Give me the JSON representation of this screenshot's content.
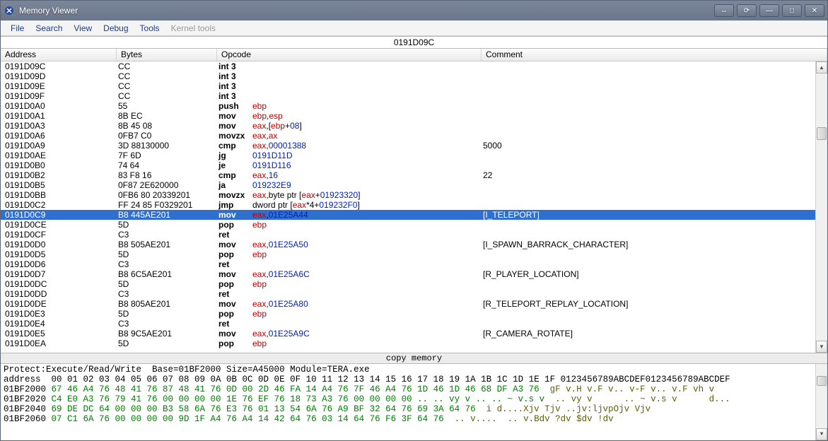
{
  "window": {
    "title": "Memory Viewer"
  },
  "titlebar_buttons": [
    "⇔",
    "⟳",
    "—",
    "□",
    "✕"
  ],
  "menu": [
    {
      "label": "File",
      "enabled": true
    },
    {
      "label": "Search",
      "enabled": true
    },
    {
      "label": "View",
      "enabled": true
    },
    {
      "label": "Debug",
      "enabled": true
    },
    {
      "label": "Tools",
      "enabled": true
    },
    {
      "label": "Kernel tools",
      "enabled": false
    }
  ],
  "current_address": "0191D09C",
  "columns": {
    "address": "Address",
    "bytes": "Bytes",
    "opcode": "Opcode",
    "comment": "Comment"
  },
  "rows": [
    {
      "addr": "0191D09C",
      "bytes": "CC",
      "mn": "int 3",
      "ops": [],
      "cmt": "",
      "sel": false
    },
    {
      "addr": "0191D09D",
      "bytes": "CC",
      "mn": "int 3",
      "ops": [],
      "cmt": "",
      "sel": false
    },
    {
      "addr": "0191D09E",
      "bytes": "CC",
      "mn": "int 3",
      "ops": [],
      "cmt": "",
      "sel": false
    },
    {
      "addr": "0191D09F",
      "bytes": "CC",
      "mn": "int 3",
      "ops": [],
      "cmt": "",
      "sel": false
    },
    {
      "addr": "0191D0A0",
      "bytes": "55",
      "mn": "push",
      "ops": [
        {
          "t": "ebp",
          "c": "reg"
        }
      ],
      "cmt": "",
      "sel": false
    },
    {
      "addr": "0191D0A1",
      "bytes": "8B EC",
      "mn": "mov",
      "ops": [
        {
          "t": "ebp",
          "c": "reg"
        },
        {
          "t": ",",
          "c": "plain"
        },
        {
          "t": "esp",
          "c": "reg"
        }
      ],
      "cmt": "",
      "sel": false
    },
    {
      "addr": "0191D0A3",
      "bytes": "8B 45 08",
      "mn": "mov",
      "ops": [
        {
          "t": "eax",
          "c": "reg"
        },
        {
          "t": ",[",
          "c": "plain"
        },
        {
          "t": "ebp",
          "c": "reg"
        },
        {
          "t": "+",
          "c": "plain"
        },
        {
          "t": "08",
          "c": "imm"
        },
        {
          "t": "]",
          "c": "plain"
        }
      ],
      "cmt": "",
      "sel": false
    },
    {
      "addr": "0191D0A6",
      "bytes": "0FB7 C0",
      "mn": "movzx",
      "ops": [
        {
          "t": "eax",
          "c": "reg"
        },
        {
          "t": ",",
          "c": "plain"
        },
        {
          "t": "ax",
          "c": "reg"
        }
      ],
      "cmt": "",
      "sel": false
    },
    {
      "addr": "0191D0A9",
      "bytes": "3D 88130000",
      "mn": "cmp",
      "ops": [
        {
          "t": "eax",
          "c": "reg"
        },
        {
          "t": ",",
          "c": "plain"
        },
        {
          "t": "00001388",
          "c": "imm"
        }
      ],
      "cmt": "5000",
      "sel": false
    },
    {
      "addr": "0191D0AE",
      "bytes": "7F 6D",
      "mn": "jg",
      "ops": [
        {
          "t": "0191D11D",
          "c": "imm"
        }
      ],
      "cmt": "",
      "sel": false
    },
    {
      "addr": "0191D0B0",
      "bytes": "74 64",
      "mn": "je",
      "ops": [
        {
          "t": "0191D116",
          "c": "imm"
        }
      ],
      "cmt": "",
      "sel": false
    },
    {
      "addr": "0191D0B2",
      "bytes": "83 F8 16",
      "mn": "cmp",
      "ops": [
        {
          "t": "eax",
          "c": "reg"
        },
        {
          "t": ",",
          "c": "plain"
        },
        {
          "t": "16",
          "c": "imm"
        }
      ],
      "cmt": "22",
      "sel": false
    },
    {
      "addr": "0191D0B5",
      "bytes": "0F87 2E620000",
      "mn": "ja",
      "ops": [
        {
          "t": "019232E9",
          "c": "imm"
        }
      ],
      "cmt": "",
      "sel": false
    },
    {
      "addr": "0191D0BB",
      "bytes": "0FB6 80 20339201",
      "mn": "movzx",
      "ops": [
        {
          "t": "eax",
          "c": "reg"
        },
        {
          "t": ",byte ptr [",
          "c": "plain"
        },
        {
          "t": "eax",
          "c": "reg"
        },
        {
          "t": "+",
          "c": "plain"
        },
        {
          "t": "01923320",
          "c": "imm"
        },
        {
          "t": "]",
          "c": "plain"
        }
      ],
      "cmt": "",
      "sel": false
    },
    {
      "addr": "0191D0C2",
      "bytes": "FF 24 85 F0329201",
      "mn": "jmp",
      "ops": [
        {
          "t": "dword ptr [",
          "c": "plain"
        },
        {
          "t": "eax",
          "c": "reg"
        },
        {
          "t": "*4+",
          "c": "plain"
        },
        {
          "t": "019232F0",
          "c": "imm"
        },
        {
          "t": "]",
          "c": "plain"
        }
      ],
      "cmt": "",
      "sel": false
    },
    {
      "addr": "0191D0C9",
      "bytes": "B8 445AE201",
      "mn": "mov",
      "ops": [
        {
          "t": "eax",
          "c": "reg"
        },
        {
          "t": ",",
          "c": "plain"
        },
        {
          "t": "01E25A44",
          "c": "imm"
        }
      ],
      "cmt": "[I_TELEPORT]",
      "sel": true
    },
    {
      "addr": "0191D0CE",
      "bytes": "5D",
      "mn": "pop",
      "ops": [
        {
          "t": "ebp",
          "c": "reg"
        }
      ],
      "cmt": "",
      "sel": false
    },
    {
      "addr": "0191D0CF",
      "bytes": "C3",
      "mn": "ret",
      "ops": [],
      "cmt": "",
      "sel": false
    },
    {
      "addr": "0191D0D0",
      "bytes": "B8 505AE201",
      "mn": "mov",
      "ops": [
        {
          "t": "eax",
          "c": "reg"
        },
        {
          "t": ",",
          "c": "plain"
        },
        {
          "t": "01E25A50",
          "c": "imm"
        }
      ],
      "cmt": "[I_SPAWN_BARRACK_CHARACTER]",
      "sel": false
    },
    {
      "addr": "0191D0D5",
      "bytes": "5D",
      "mn": "pop",
      "ops": [
        {
          "t": "ebp",
          "c": "reg"
        }
      ],
      "cmt": "",
      "sel": false
    },
    {
      "addr": "0191D0D6",
      "bytes": "C3",
      "mn": "ret",
      "ops": [],
      "cmt": "",
      "sel": false
    },
    {
      "addr": "0191D0D7",
      "bytes": "B8 6C5AE201",
      "mn": "mov",
      "ops": [
        {
          "t": "eax",
          "c": "reg"
        },
        {
          "t": ",",
          "c": "plain"
        },
        {
          "t": "01E25A6C",
          "c": "imm"
        }
      ],
      "cmt": "[R_PLAYER_LOCATION]",
      "sel": false
    },
    {
      "addr": "0191D0DC",
      "bytes": "5D",
      "mn": "pop",
      "ops": [
        {
          "t": "ebp",
          "c": "reg"
        }
      ],
      "cmt": "",
      "sel": false
    },
    {
      "addr": "0191D0DD",
      "bytes": "C3",
      "mn": "ret",
      "ops": [],
      "cmt": "",
      "sel": false
    },
    {
      "addr": "0191D0DE",
      "bytes": "B8 805AE201",
      "mn": "mov",
      "ops": [
        {
          "t": "eax",
          "c": "reg"
        },
        {
          "t": ",",
          "c": "plain"
        },
        {
          "t": "01E25A80",
          "c": "imm"
        }
      ],
      "cmt": "[R_TELEPORT_REPLAY_LOCATION]",
      "sel": false
    },
    {
      "addr": "0191D0E3",
      "bytes": "5D",
      "mn": "pop",
      "ops": [
        {
          "t": "ebp",
          "c": "reg"
        }
      ],
      "cmt": "",
      "sel": false
    },
    {
      "addr": "0191D0E4",
      "bytes": "C3",
      "mn": "ret",
      "ops": [],
      "cmt": "",
      "sel": false
    },
    {
      "addr": "0191D0E5",
      "bytes": "B8 9C5AE201",
      "mn": "mov",
      "ops": [
        {
          "t": "eax",
          "c": "reg"
        },
        {
          "t": ",",
          "c": "plain"
        },
        {
          "t": "01E25A9C",
          "c": "imm"
        }
      ],
      "cmt": "[R_CAMERA_ROTATE]",
      "sel": false
    },
    {
      "addr": "0191D0EA",
      "bytes": "5D",
      "mn": "pop",
      "ops": [
        {
          "t": "ebp",
          "c": "reg"
        }
      ],
      "cmt": "",
      "sel": false
    }
  ],
  "splitter_label": "copy memory",
  "hex": {
    "info": "Protect:Execute/Read/Write  Base=01BF2000 Size=A45000 Module=TERA.exe",
    "header": "address  00 01 02 03 04 05 06 07 08 09 0A 0B 0C 0D 0E 0F 10 11 12 13 14 15 16 17 18 19 1A 1B 1C 1D 1E 1F 0123456789ABCDEF0123456789ABCDEF",
    "rows": [
      {
        "addr": "01BF2000",
        "b": "67 46 A4 76 48 41 76 87 48 41 76 0D 00 2D 46 FA 14 A4 76 7F 46 A4 76 1D 46 1D 46 68 DF A3 76",
        "asc": "gF v.H v.F v.. v-F v.. v.F vh v"
      },
      {
        "addr": "01BF2020",
        "b": "C4 E0 A3 76 79 41 76 00 00 00 00 1E 76 EF 76 18 73 A3 76 00 00 00 00 .. .. vy v .. .. ~ v.s v",
        "asc": ".. vy v      .. ~ v.s v      d..."
      },
      {
        "addr": "01BF2040",
        "b": "69 DE DC 64 00 00 00 B3 58 6A 76 E3 76 01 13 54 6A 76 A9 BF 32 64 76 69 3A 64 76",
        "asc": "i d....Xjv Tjv ..jv:ljvpOjv Vjv"
      },
      {
        "addr": "01BF2060",
        "b": "07 C1 6A 76 00 00 00 00 9D 1F A4 76 A4 14 42 64 76 03 14 64 76 F6 3F 64 76",
        "asc": ".. v....  .. v.Bdv ?dv $dv !dv"
      }
    ]
  }
}
